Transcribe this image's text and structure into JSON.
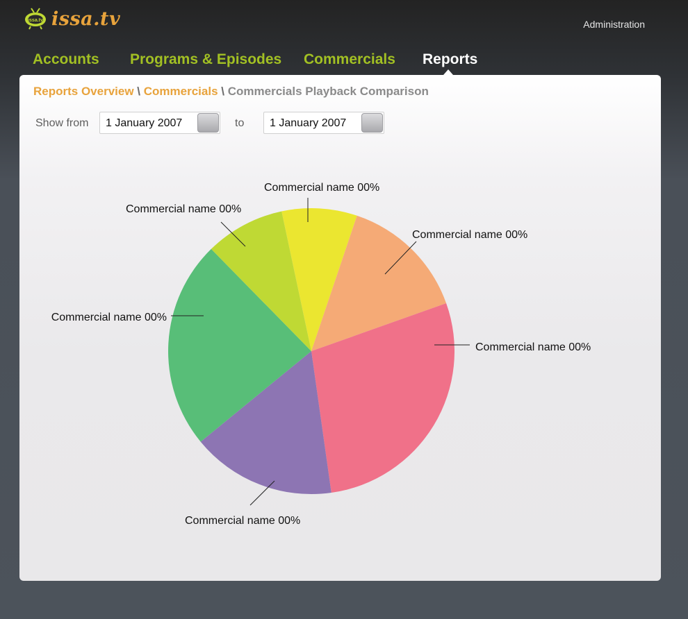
{
  "app": {
    "logo_text": "issa.tv",
    "logo_badge_text": "issa.tv",
    "admin_label": "Administration"
  },
  "nav": {
    "items": [
      {
        "label": "Accounts",
        "active": false
      },
      {
        "label": "Programs & Episodes",
        "active": false
      },
      {
        "label": "Commercials",
        "active": false
      },
      {
        "label": "Reports",
        "active": true
      }
    ]
  },
  "breadcrumb": {
    "items": [
      "Reports Overview",
      "Commercials"
    ],
    "current": "Commercials Playback Comparison",
    "separator": "\\"
  },
  "filter": {
    "show_from_label": "Show from",
    "from_value": "1 January 2007",
    "to_label": "to",
    "to_value": "1 January 2007"
  },
  "colors": {
    "accent_green": "#a2c023",
    "accent_orange": "#e8a33c"
  },
  "chart_data": {
    "type": "pie",
    "title": "",
    "slices": [
      {
        "label": "Commercial name 00%",
        "value": 8.5,
        "color": "#ebe630"
      },
      {
        "label": "Commercial name 00%",
        "value": 14.4,
        "color": "#f5aa76"
      },
      {
        "label": "Commercial name 00%",
        "value": 28.2,
        "color": "#f07189"
      },
      {
        "label": "Commercial name 00%",
        "value": 16.3,
        "color": "#8d75b3"
      },
      {
        "label": "Commercial name 00%",
        "value": 23.6,
        "color": "#58be78"
      },
      {
        "label": "Commercial name 00%",
        "value": 9.0,
        "color": "#bfd934"
      }
    ]
  }
}
